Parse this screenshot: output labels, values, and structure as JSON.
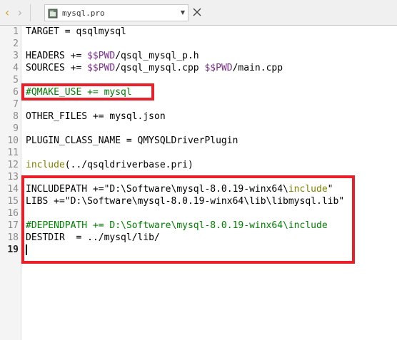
{
  "tabbar": {
    "file_name": "mysql.pro"
  },
  "lines": [
    {
      "num": "1",
      "segments": [
        {
          "t": "TARGET = qsqlmysql",
          "c": ""
        }
      ]
    },
    {
      "num": "2",
      "segments": []
    },
    {
      "num": "3",
      "segments": [
        {
          "t": "HEADERS += ",
          "c": ""
        },
        {
          "t": "$$PWD",
          "c": "var"
        },
        {
          "t": "/qsql_mysql_p.h",
          "c": ""
        }
      ]
    },
    {
      "num": "4",
      "segments": [
        {
          "t": "SOURCES += ",
          "c": ""
        },
        {
          "t": "$$PWD",
          "c": "var"
        },
        {
          "t": "/qsql_mysql.cpp ",
          "c": ""
        },
        {
          "t": "$$PWD",
          "c": "var"
        },
        {
          "t": "/main.cpp",
          "c": ""
        }
      ]
    },
    {
      "num": "5",
      "segments": []
    },
    {
      "num": "6",
      "segments": [
        {
          "t": "#QMAKE_USE += mysql",
          "c": "cmt"
        }
      ]
    },
    {
      "num": "7",
      "segments": []
    },
    {
      "num": "8",
      "segments": [
        {
          "t": "OTHER_FILES += mysql.json",
          "c": ""
        }
      ]
    },
    {
      "num": "9",
      "segments": []
    },
    {
      "num": "10",
      "segments": [
        {
          "t": "PLUGIN_CLASS_NAME = QMYSQLDriverPlugin",
          "c": ""
        }
      ]
    },
    {
      "num": "11",
      "segments": []
    },
    {
      "num": "12",
      "segments": [
        {
          "t": "include",
          "c": "kw"
        },
        {
          "t": "(../qsqldriverbase.pri)",
          "c": ""
        }
      ]
    },
    {
      "num": "13",
      "segments": []
    },
    {
      "num": "14",
      "segments": [
        {
          "t": "INCLUDEPATH +=\"D:\\Software\\mysql-8.0.19-winx64\\",
          "c": ""
        },
        {
          "t": "include",
          "c": "kw"
        },
        {
          "t": "\"",
          "c": ""
        }
      ]
    },
    {
      "num": "15",
      "segments": [
        {
          "t": "LIBS +=\"D:\\Software\\mysql-8.0.19-winx64\\lib\\libmysql.lib\"",
          "c": ""
        }
      ]
    },
    {
      "num": "16",
      "segments": []
    },
    {
      "num": "17",
      "segments": [
        {
          "t": "#DEPENDPATH += D:\\Software\\mysql-8.0.19-winx64\\include",
          "c": "cmt"
        }
      ]
    },
    {
      "num": "18",
      "segments": [
        {
          "t": "DESTDIR  = ../mysql/lib/",
          "c": ""
        }
      ]
    },
    {
      "num": "19",
      "segments": [],
      "active": true,
      "cursor": true
    }
  ],
  "colors": {
    "highlight": "#e8202a",
    "variable": "#7b2c8f",
    "comment": "#008000",
    "keyword": "#808000",
    "back_arrow": "#d4a017"
  },
  "icons": {
    "back": "chevron-left-icon",
    "forward": "chevron-right-icon",
    "file": "qt-project-file-icon",
    "dropdown": "dropdown-arrow-icon",
    "close": "close-icon"
  }
}
